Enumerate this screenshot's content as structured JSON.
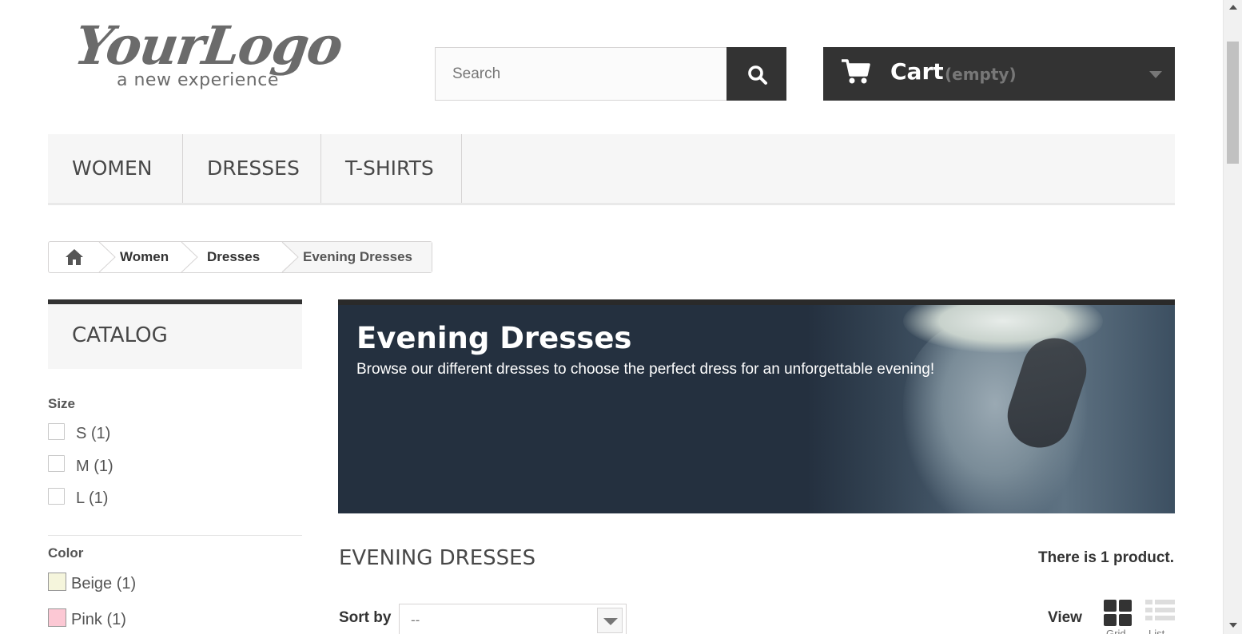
{
  "header": {
    "logo_text": "YourLogo",
    "logo_tagline": "a new experience",
    "search_placeholder": "Search",
    "cart_label": "Cart",
    "cart_status": "(empty)"
  },
  "menu": {
    "items": [
      "WOMEN",
      "DRESSES",
      "T-SHIRTS"
    ]
  },
  "breadcrumb": {
    "items": [
      "Women",
      "Dresses",
      "Evening Dresses"
    ]
  },
  "sidebar": {
    "catalog_title": "CATALOG",
    "size_title": "Size",
    "sizes": [
      "S (1)",
      "M (1)",
      "L (1)"
    ],
    "color_title": "Color",
    "colors": [
      {
        "label": "Beige (1)",
        "swatch": "#f5f5dc"
      },
      {
        "label": "Pink (1)",
        "swatch": "#fcc8d4"
      }
    ]
  },
  "banner": {
    "title": "Evening Dresses",
    "description": "Browse our different dresses to choose the perfect dress for an unforgettable evening!"
  },
  "category": {
    "heading": "EVENING DRESSES",
    "product_count": "There is 1 product."
  },
  "toolbar": {
    "sort_label": "Sort by",
    "sort_value": "--",
    "view_label": "View",
    "grid_label": "Grid",
    "list_label": "List"
  },
  "colors": {
    "dark": "#333333",
    "panel": "#f6f6f6",
    "banner_bg": "#24303f"
  }
}
